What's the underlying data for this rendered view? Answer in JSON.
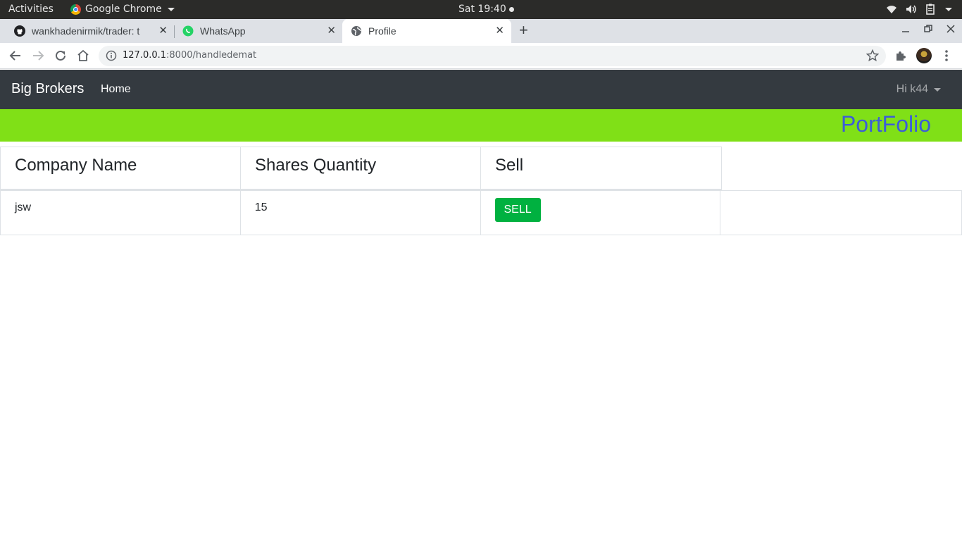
{
  "os": {
    "activities": "Activities",
    "app_name": "Google Chrome",
    "clock": "Sat 19:40"
  },
  "tabs": [
    {
      "title": "wankhadenirmik/trader: t",
      "icon": "github-icon",
      "active": false
    },
    {
      "title": "WhatsApp",
      "icon": "whatsapp-icon",
      "active": false
    },
    {
      "title": "Profile",
      "icon": "globe-icon",
      "active": true
    }
  ],
  "toolbar": {
    "url_host": "127.0.0.1",
    "url_path": ":8000/handledemat"
  },
  "navbar": {
    "brand": "Big Brokers",
    "home": "Home",
    "user": "Hi k44"
  },
  "banner": {
    "title": "PortFolio"
  },
  "table": {
    "headers": [
      "Company Name",
      "Shares Quantity",
      "Sell"
    ],
    "rows": [
      {
        "company": "jsw",
        "quantity": "15",
        "action": "SELL"
      }
    ]
  },
  "colors": {
    "navbar": "#343a40",
    "banner": "#80e017",
    "banner_title": "#3c5dd8",
    "sell_button": "#00b140"
  }
}
